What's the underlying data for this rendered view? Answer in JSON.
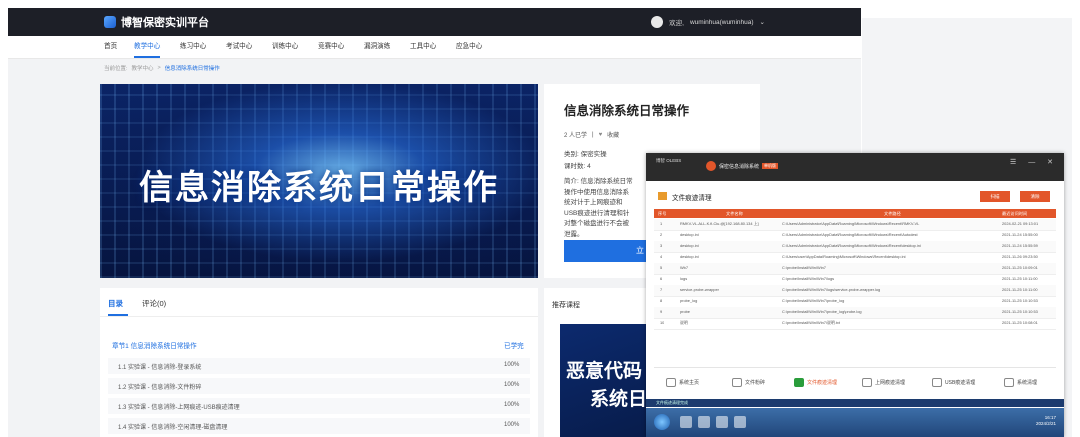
{
  "header": {
    "logo": "博智保密实训平台",
    "welcome": "欢迎,",
    "user": "wuminhua(wuminhua)",
    "chevron": "⌄"
  },
  "nav": [
    {
      "label": "首页"
    },
    {
      "label": "教学中心",
      "active": true
    },
    {
      "label": "练习中心"
    },
    {
      "label": "考试中心"
    },
    {
      "label": "训练中心"
    },
    {
      "label": "竞赛中心"
    },
    {
      "label": "漏洞演练"
    },
    {
      "label": "工具中心"
    },
    {
      "label": "应急中心"
    }
  ],
  "breadcrumb": {
    "prefix": "当前位置:",
    "level1": "教学中心",
    "sep": ">",
    "current": "信息消除系统日常操作"
  },
  "hero": {
    "title": "信息消除系统日常操作"
  },
  "course": {
    "title": "信息消除系统日常操作",
    "learners": "2 人已学",
    "sep": "|",
    "fav": "收藏",
    "category": "类别: 保密实操",
    "hours": "课时数: 4",
    "description": "简介: 信息消除系统日常操作中使用信息消除系统对计于上网痕迹和USB痕迹进行清理和针对整个磁盘进行不会被泄露。",
    "start": "立"
  },
  "toc": {
    "tab_catalog": "目录",
    "tab_comments": "评论(0)",
    "chapter": "章节1 信息消除系统日常操作",
    "chapter_status": "已学完",
    "lessons": [
      {
        "title": "1.1 实验课 - 信息消除-登录系统",
        "progress": "100%"
      },
      {
        "title": "1.2 实验课 - 信息消除-文件粉碎",
        "progress": "100%"
      },
      {
        "title": "1.3 实验课 - 信息消除-上网痕迹-USB痕迹清理",
        "progress": "100%"
      },
      {
        "title": "1.4 实验课 - 信息消除-空闲清理-磁盘清理",
        "progress": "100%"
      }
    ]
  },
  "recommend": {
    "title": "推荐课程",
    "thumb_line1": "恶意代码",
    "thumb_line2": "系统日"
  },
  "app": {
    "brand": "博智 OLEBS",
    "name": "保密信息消除系统",
    "badge": "单机版",
    "window_controls": "☰ — ✕",
    "section": "文件痕迹清理",
    "btn_scan": "扫描",
    "btn_clean": "清除",
    "columns": [
      "序号",
      "文件名称",
      "文件路径",
      "最近访问时间"
    ],
    "rows": [
      [
        "1",
        "RMKV-VL-ALL-K.fi-Ciu.@[192.168.80.134 上]",
        "C:\\Users\\Administrator\\AppData\\Roaming\\Microsoft\\Windows\\Recent\\RMKV-VL",
        "2024-02-21 09:13:01"
      ],
      [
        "2",
        "desktop.ini",
        "C:\\Users\\Administrator\\AppData\\Roaming\\Microsoft\\Windows\\Recent\\Autodest",
        "2021-11-24 15:55:00"
      ],
      [
        "3",
        "desktop.ini",
        "C:\\Users\\Administrator\\AppData\\Roaming\\Microsoft\\Windows\\Recent\\desktop.ini",
        "2021-11-24 15:55:59"
      ],
      [
        "4",
        "desktop.ini",
        "C:\\Users\\user\\AppData\\Roaming\\Microsoft\\Windows\\Recent\\desktop.ini",
        "2021-11-26 09:23:50"
      ],
      [
        "5",
        "Wb7",
        "C:\\probe\\Install\\Win\\Win7",
        "2021-11-25 10:09:01"
      ],
      [
        "6",
        "logs",
        "C:\\probe\\Install\\Win\\Win7\\logs",
        "2021-11-25 10:11:00"
      ],
      [
        "7",
        "service-probe-wrapper",
        "C:\\probe\\Install\\Win\\Win7\\logs\\service-probe-wrapper.log",
        "2021-11-25 10:11:00"
      ],
      [
        "8",
        "probe_log",
        "C:\\probe\\Install\\Win\\Win7\\probe_log",
        "2021-11-25 10:10:53"
      ],
      [
        "9",
        "probe",
        "C:\\probe\\Install\\Win\\Win7\\probe_log\\probe.log",
        "2021-11-25 10:10:53"
      ],
      [
        "10",
        "说明",
        "C:\\probe\\Install\\Win\\Win7\\说明.txt",
        "2021-11-25 10:08:01"
      ]
    ],
    "tools": [
      {
        "label": "系统主页"
      },
      {
        "label": "文件粉碎"
      },
      {
        "label": "文件痕迹清理",
        "active": true
      },
      {
        "label": "上网痕迹清理"
      },
      {
        "label": "USB痕迹清理"
      },
      {
        "label": "系统清理"
      }
    ],
    "status": "文件痕迹清理完成",
    "clock_time": "16:17",
    "clock_date": "2024/2/21"
  }
}
